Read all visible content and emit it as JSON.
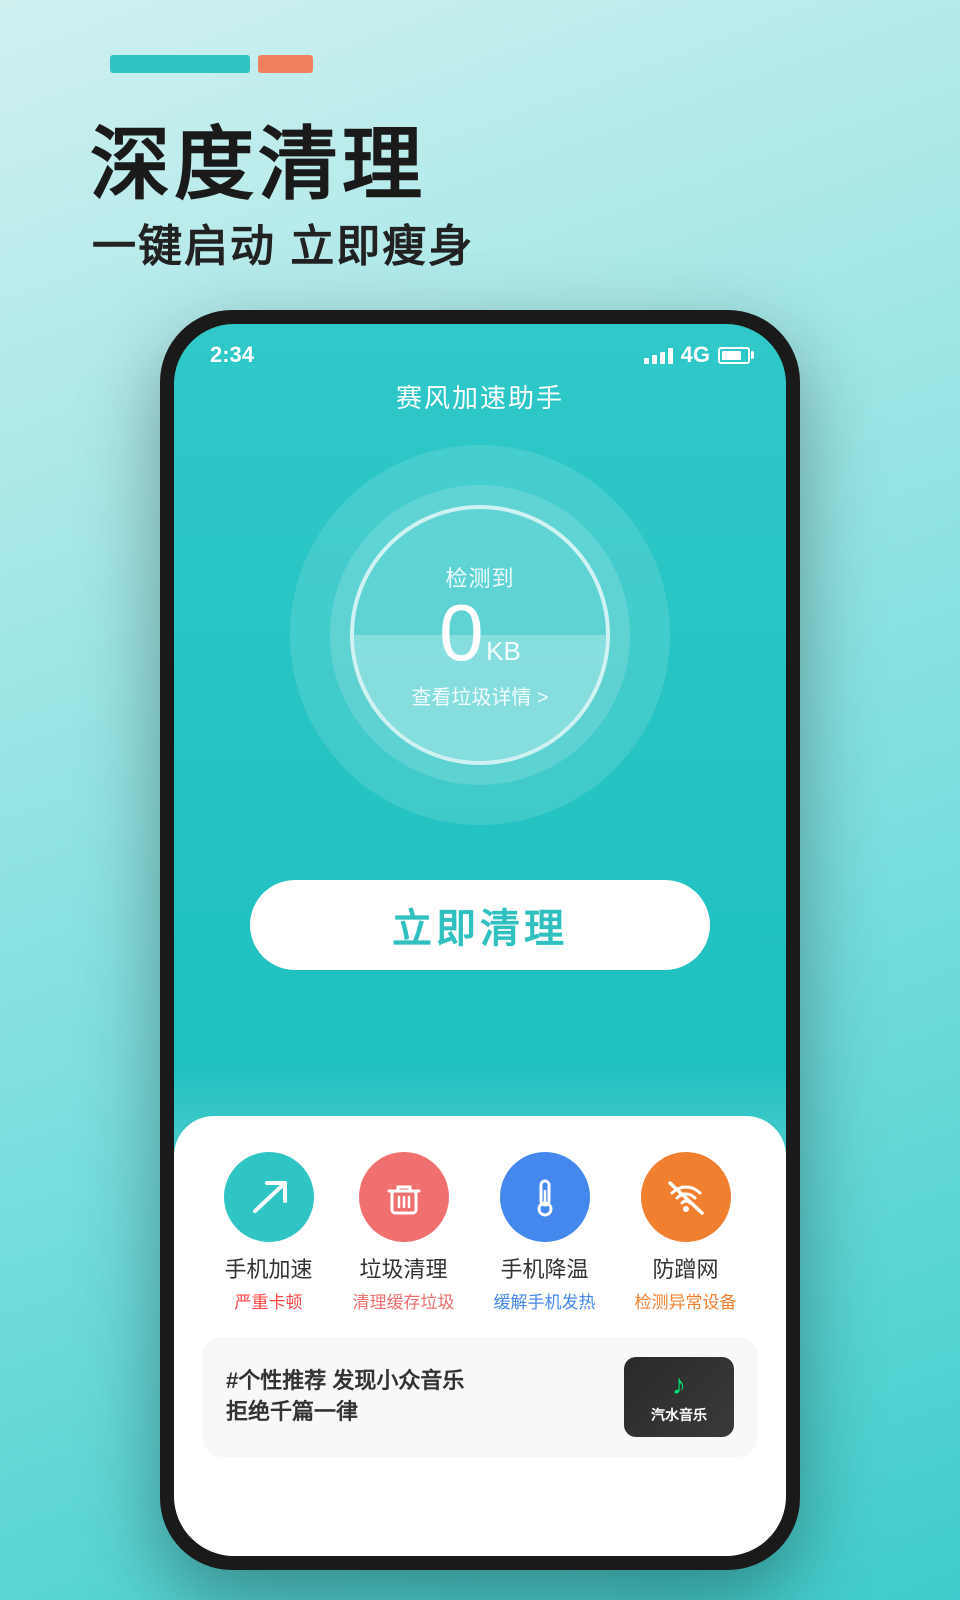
{
  "top_stripes": {
    "teal_label": "teal stripe",
    "orange_label": "orange stripe"
  },
  "header": {
    "main_title": "深度清理",
    "sub_title": "一键启动 立即瘦身"
  },
  "phone": {
    "status_bar": {
      "time": "2:34",
      "network": "4G"
    },
    "app_title": "赛风加速助手",
    "circle": {
      "detected_label": "检测到",
      "detected_value": "0",
      "detected_unit": "KB",
      "detail_link": "查看垃圾详情 >"
    },
    "clean_button_label": "立即清理",
    "icons": [
      {
        "name": "phone-boost",
        "bg_color": "#30c5c5",
        "main_label": "手机加速",
        "sub_label": "严重卡顿",
        "sub_color": "#f44"
      },
      {
        "name": "trash-clean",
        "bg_color": "#f07070",
        "main_label": "垃圾清理",
        "sub_label": "清理缓存垃圾",
        "sub_color": "#f07070"
      },
      {
        "name": "phone-cool",
        "bg_color": "#4488ee",
        "main_label": "手机降温",
        "sub_label": "缓解手机发热",
        "sub_color": "#4488ee"
      },
      {
        "name": "anti-freeload",
        "bg_color": "#f08030",
        "main_label": "防蹭网",
        "sub_label": "检测异常设备",
        "sub_color": "#f08030"
      }
    ],
    "music_card": {
      "title_line1": "#个性推荐 发现小众音乐",
      "title_line2": "拒绝千篇一律",
      "app_logo": "♪",
      "app_name": "汽水音乐"
    }
  }
}
